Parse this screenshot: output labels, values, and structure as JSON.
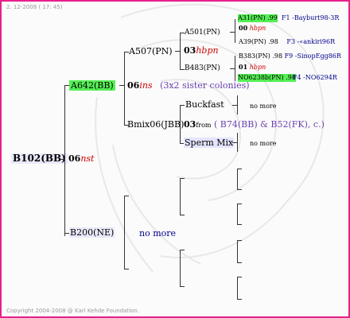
{
  "date": "2. 12-2008 ( 17: 45)",
  "copyright": "Copyright 2004-2008 @ Karl Kehde Foundation.",
  "subject": {
    "ring": "B102(BB)",
    "year": "06",
    "note": "nst"
  },
  "sire": {
    "ring": "A642(BB)",
    "year": "06",
    "note": "ins",
    "comment": "(3x2 sister colonies)"
  },
  "ss": {
    "ring": "A507(PN)",
    "year": "03",
    "note": "hbpn"
  },
  "sss": {
    "ring": "A501(PN)"
  },
  "ssd": {
    "ring": "B483(PN)"
  },
  "ssss": {
    "ring": "A31(PN) .99",
    "note": "F1 -Bayburt98-3R"
  },
  "sssd_mid": {
    "year": "00",
    "note": "hbpn"
  },
  "sssd": {
    "ring": "A39(PN) .98",
    "note": "F3 -«ankiri96R"
  },
  "ssds": {
    "ring": "B383(PN) .98",
    "note": "F9 -SinopEgg86R"
  },
  "ssd_mid": {
    "year": "01",
    "note": "hbpn"
  },
  "ssdd": {
    "ring": "NO6238b(PN) .98",
    "note": "F4 -NO6294R"
  },
  "sd": {
    "ring": "Bmix06(JBB)",
    "year": "03",
    "from": "from",
    "comment": "( B74(BB) & B52(FK), c.)"
  },
  "sds": {
    "ring": "Buckfast",
    "more": "no more"
  },
  "sdd": {
    "ring": "Sperm Mix",
    "more": "no more"
  },
  "dam": {
    "ring": "B200(NE)",
    "more": "no more"
  }
}
